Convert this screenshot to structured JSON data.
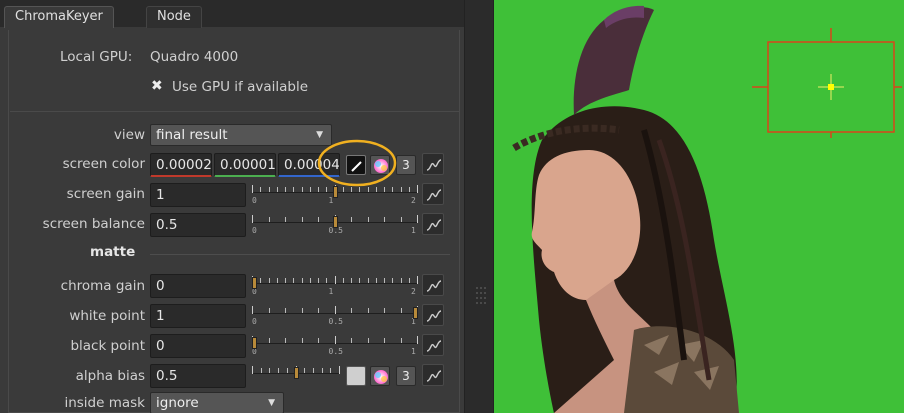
{
  "tabs": {
    "active": "ChromaKeyer",
    "inactive": "Node"
  },
  "gpu": {
    "label": "Local GPU:",
    "value": "Quadro 4000",
    "checkbox_mark": "✖",
    "checkbox_label": "Use GPU if available"
  },
  "params": {
    "view": {
      "label": "view",
      "value": "final result"
    },
    "screen_color": {
      "label": "screen color",
      "r": "0.00002",
      "g": "0.00001",
      "b": "0.00004",
      "channels": "3"
    },
    "screen_gain": {
      "label": "screen gain",
      "value": "1",
      "ticks": [
        "0",
        "1",
        "2"
      ],
      "level": 0.5
    },
    "screen_balance": {
      "label": "screen balance",
      "value": "0.5",
      "ticks": [
        "0",
        "0.5",
        "1"
      ],
      "level": 0.5
    },
    "matte_heading": "matte",
    "chroma_gain": {
      "label": "chroma gain",
      "value": "0",
      "ticks": [
        "0",
        "1",
        "2"
      ],
      "level": 0.0
    },
    "white_point": {
      "label": "white point",
      "value": "1",
      "ticks": [
        "0",
        "0.5",
        "1"
      ],
      "level": 1.0
    },
    "black_point": {
      "label": "black point",
      "value": "0",
      "ticks": [
        "0",
        "0.5",
        "1"
      ],
      "level": 0.0
    },
    "alpha_bias": {
      "label": "alpha bias",
      "value": "0.5",
      "channels": "3",
      "level": 0.5
    },
    "inside_mask": {
      "label": "inside mask",
      "value": "ignore"
    }
  },
  "icons": {
    "picker": "color-picker-icon",
    "wheel": "color-wheel-icon",
    "anim": "animation-curve-icon"
  },
  "colors": {
    "highlight_circle": "#f0b020",
    "overlay_box": "#d9461a",
    "crosshair_center": "#ffff00",
    "green_screen": "#3fc038"
  }
}
